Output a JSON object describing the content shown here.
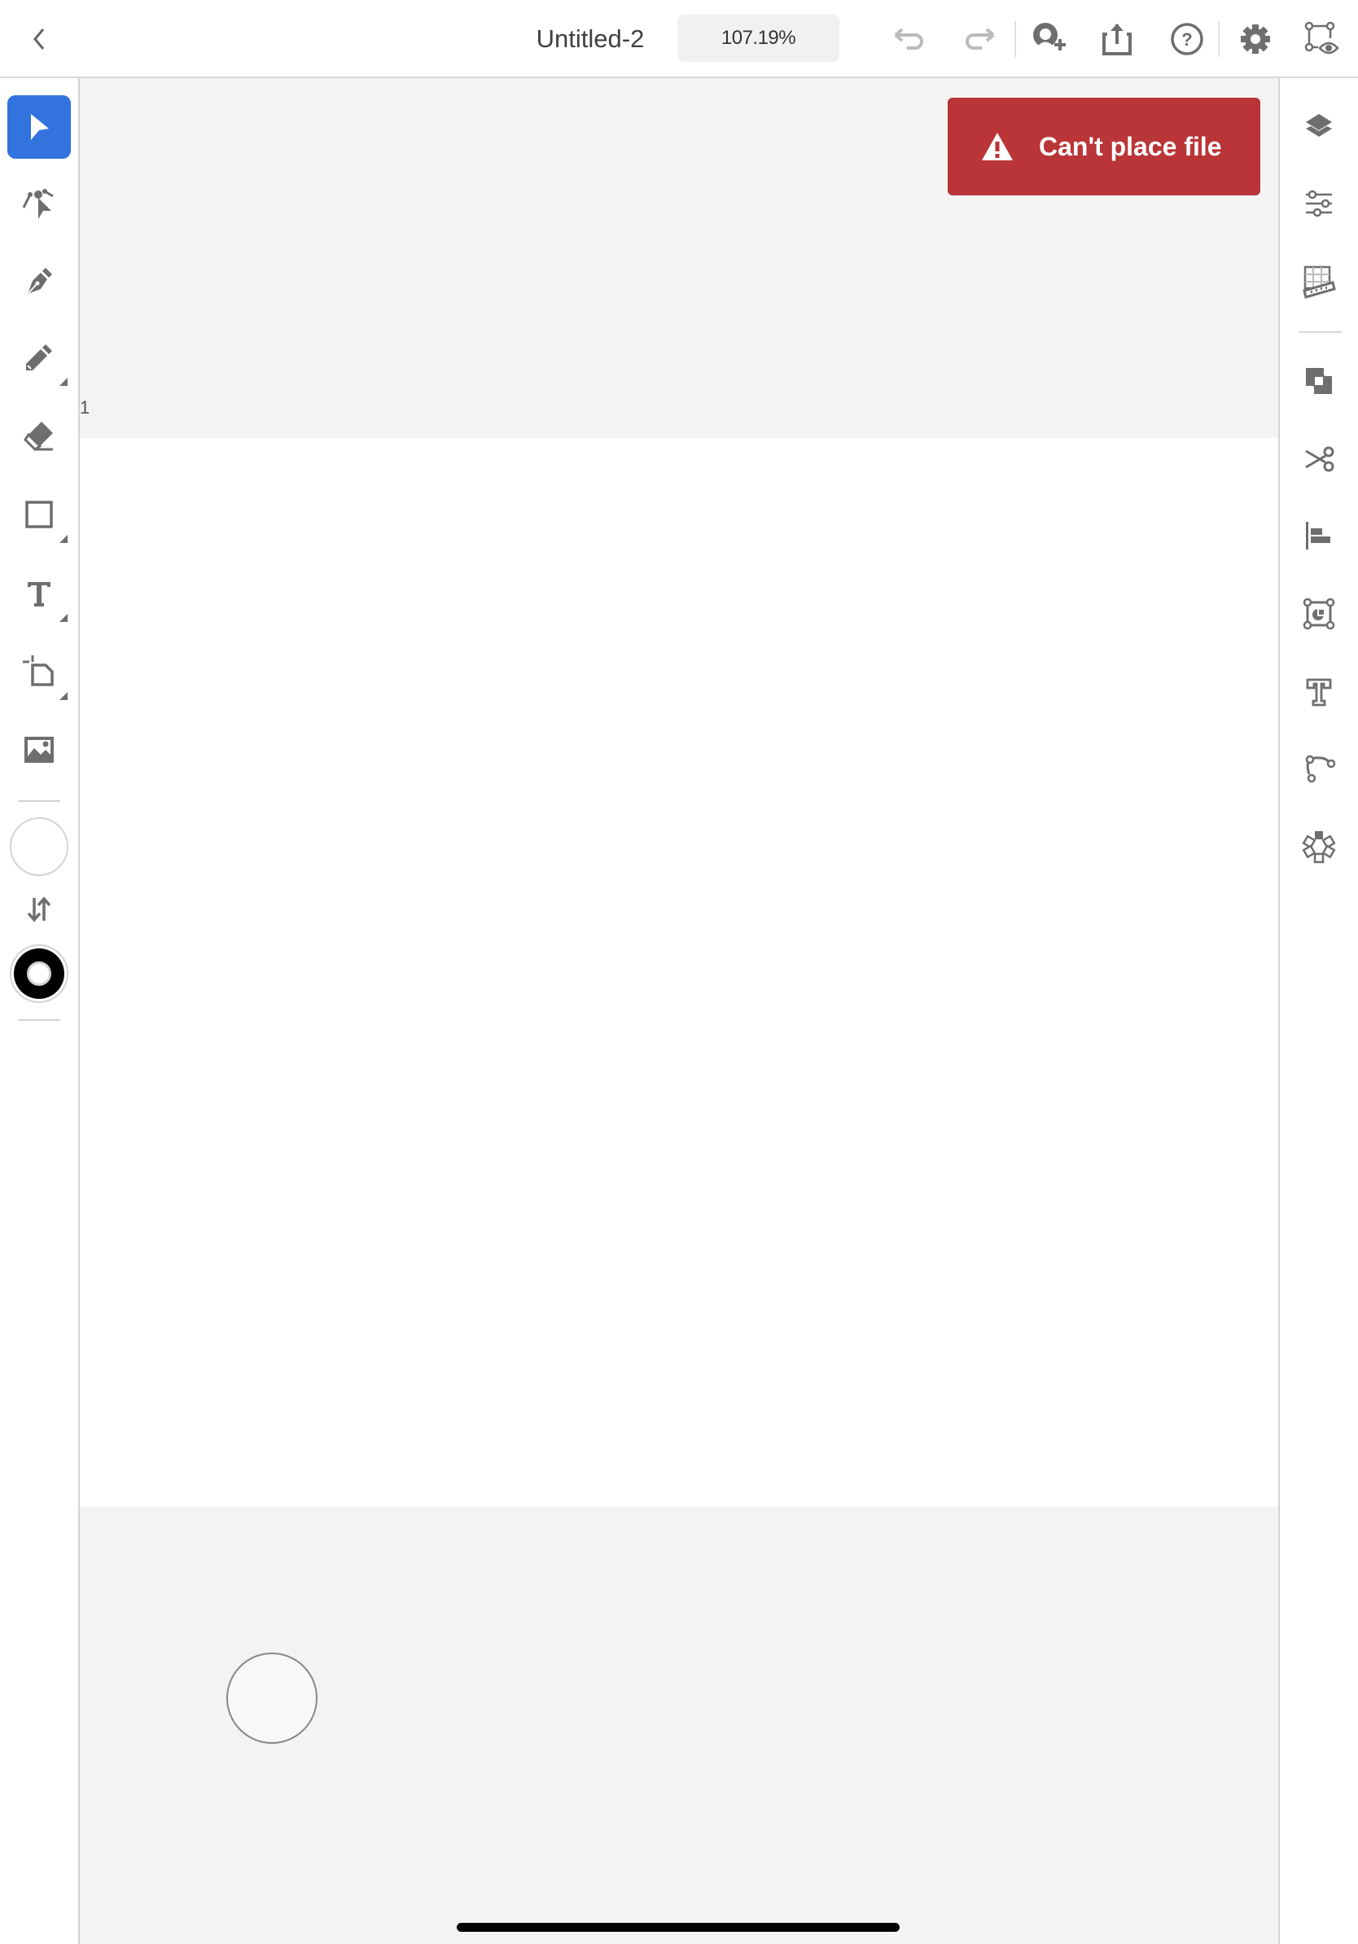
{
  "header": {
    "back_label": "Back",
    "title": "Untitled-2",
    "zoom_level": "107.19%",
    "icons": [
      "undo-icon",
      "redo-icon",
      "invite-user-icon",
      "share-icon",
      "help-icon",
      "settings-icon",
      "preview-icon"
    ]
  },
  "toolbar": {
    "tools": [
      {
        "name": "selection-tool",
        "active": true
      },
      {
        "name": "direct-selection-tool",
        "active": false
      },
      {
        "name": "pen-tool",
        "active": false
      },
      {
        "name": "pencil-tool",
        "active": false
      },
      {
        "name": "eraser-tool",
        "active": false
      },
      {
        "name": "shape-tool",
        "active": false
      },
      {
        "name": "text-tool",
        "active": false
      },
      {
        "name": "artboard-tool",
        "active": false
      },
      {
        "name": "place-image-tool",
        "active": false
      }
    ],
    "fill_color": "#ffffff",
    "stroke_color": "#000000"
  },
  "canvas": {
    "artboard_label": "1",
    "background_color": "#f3f3f3",
    "artboard_color": "#ffffff"
  },
  "toast": {
    "message": "Can't place file",
    "color": "#b93537"
  },
  "right_panel": {
    "icons": [
      "layers-icon",
      "properties-icon",
      "grid-ruler-icon",
      "pathfinder-icon",
      "cut-icon",
      "align-icon",
      "transform-icon",
      "type-outline-icon",
      "path-icon",
      "repeat-icon"
    ]
  },
  "accent_color": "#3273de"
}
